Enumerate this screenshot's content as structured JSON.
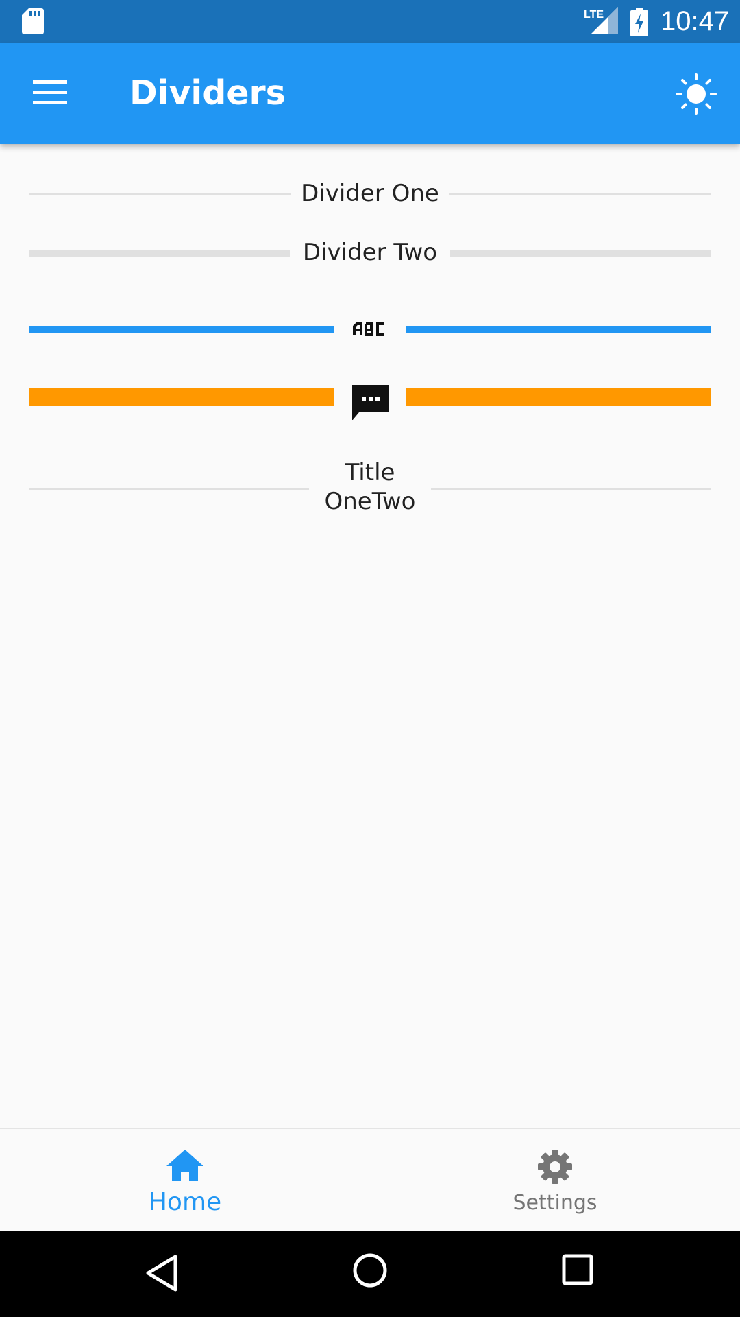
{
  "status_bar": {
    "time": "10:47",
    "network_label": "LTE",
    "icons": [
      "sd-card-icon",
      "lte-signal-icon",
      "battery-charging-icon"
    ]
  },
  "app_bar": {
    "title": "Dividers",
    "left_icon": "menu-icon",
    "right_icon": "brightness-icon",
    "background": "#2196f3"
  },
  "dividers": [
    {
      "label": "Divider One",
      "color": "#e0e0e0"
    },
    {
      "label": "Divider Two",
      "color": "#e0e0e0"
    },
    {
      "icon": "abc-icon",
      "color": "#2196f3"
    },
    {
      "icon": "chat-bubble-icon",
      "color": "#ff9800"
    },
    {
      "label_line1": "Title",
      "label_line2": "OneTwo",
      "color": "#e0e0e0"
    }
  ],
  "bottom_nav": {
    "items": [
      {
        "label": "Home",
        "icon": "home-icon",
        "active": true,
        "color": "#2196f3"
      },
      {
        "label": "Settings",
        "icon": "settings-icon",
        "active": false,
        "color": "#757575"
      }
    ]
  },
  "system_nav": {
    "buttons": [
      "back-icon",
      "home-circle-icon",
      "recents-icon"
    ]
  }
}
